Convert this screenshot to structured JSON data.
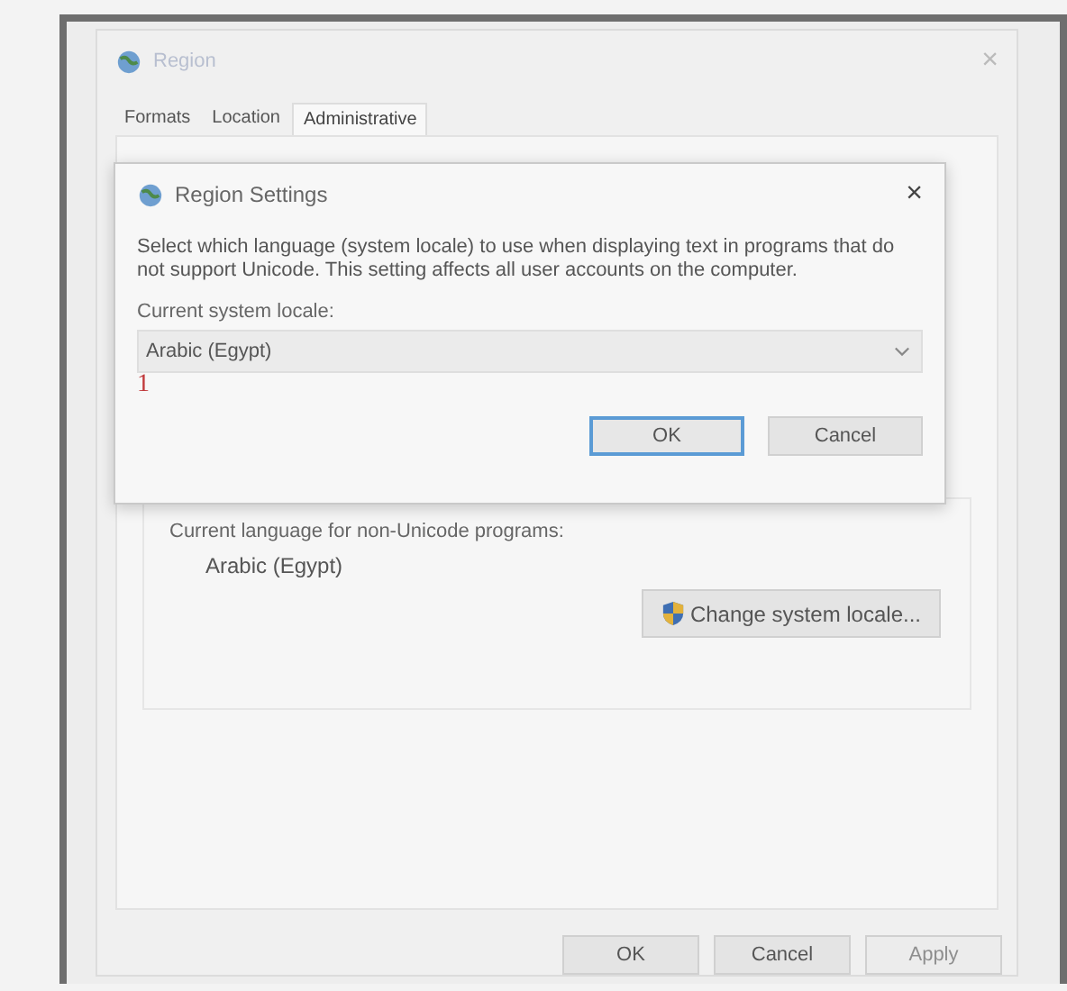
{
  "window": {
    "title": "Region",
    "close": "×"
  },
  "tabs": [
    {
      "label": "Formats",
      "selected": false
    },
    {
      "label": "Location",
      "selected": false
    },
    {
      "label": "Administrative",
      "selected": true
    }
  ],
  "language_group": {
    "heading": "Current language for non-Unicode programs:",
    "value": "Arabic (Egypt)",
    "button": "Change system locale..."
  },
  "buttons": [
    {
      "label": "OK",
      "disabled": false
    },
    {
      "label": "Cancel",
      "disabled": false
    },
    {
      "label": "Apply",
      "disabled": true
    }
  ],
  "dialog": {
    "title": "Region Settings",
    "close": "×",
    "description": "Select which language (system locale) to use when displaying text in programs that do not support Unicode. This setting affects all user accounts on the computer.",
    "locale_label": "Current system locale:",
    "locale_value": "Arabic (Egypt)",
    "annotation": "1",
    "buttons": [
      {
        "label": "OK",
        "default": true
      },
      {
        "label": "Cancel",
        "default": false
      }
    ]
  }
}
